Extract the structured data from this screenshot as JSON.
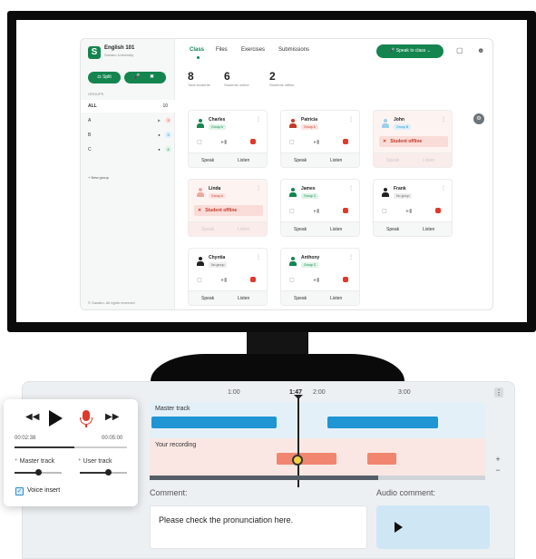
{
  "app": {
    "brand": "English 101",
    "brand_sub": "Sanako University",
    "split_label": "Split",
    "nav": [
      "Class",
      "Files",
      "Exercises",
      "Submissions"
    ],
    "speak_to_class": "Speak to class",
    "groups_label": "GROUPS",
    "groups": [
      {
        "name": "ALL",
        "count": "10"
      },
      {
        "name": "A",
        "count": "3"
      },
      {
        "name": "B",
        "count": "3"
      },
      {
        "name": "C",
        "count": "4"
      }
    ],
    "new_group": "+ New group",
    "copyright": "© Sanako. All rights reserved",
    "stats": [
      {
        "value": "8",
        "label": "Total students"
      },
      {
        "value": "6",
        "label": "Students online"
      },
      {
        "value": "2",
        "label": "Students offline"
      }
    ],
    "students": [
      {
        "name": "Charles",
        "tag": "Group A",
        "offline": false
      },
      {
        "name": "Patricia",
        "tag": "Group A",
        "offline": false
      },
      {
        "name": "John",
        "tag": "Group B",
        "offline": true
      },
      {
        "name": "Linda",
        "tag": "Group A",
        "offline": true
      },
      {
        "name": "James",
        "tag": "Group C",
        "offline": false
      },
      {
        "name": "Frank",
        "tag": "No group",
        "offline": false
      },
      {
        "name": "Chyntia",
        "tag": "No group",
        "offline": false
      },
      {
        "name": "Anthony",
        "tag": "Group C",
        "offline": false
      }
    ],
    "offline_text": "Student offline",
    "speak_label": "Speak",
    "listen_label": "Listen"
  },
  "recorder": {
    "ticks": [
      "1:00",
      "1:47",
      "2:00",
      "3:00"
    ],
    "master_track": "Master track",
    "your_recording": "Your recording",
    "comment_label": "Comment:",
    "audio_comment_label": "Audio comment:",
    "comment_text": "Please check the pronunciation here.",
    "elapsed": "00:02:38",
    "total": "00:05:00",
    "progress_fraction": 0.53,
    "scroll_fraction": 0.68,
    "master_level": 0.5,
    "user_level": 0.6,
    "master_label": "Master track",
    "user_label": "User track",
    "voice_insert": "Voice insert"
  },
  "colors": {
    "accent": "#14854f",
    "offline": "#c43a2b",
    "record": "#e0392b",
    "master_seg": "#1f95d3",
    "user_seg": "#f0866f"
  }
}
